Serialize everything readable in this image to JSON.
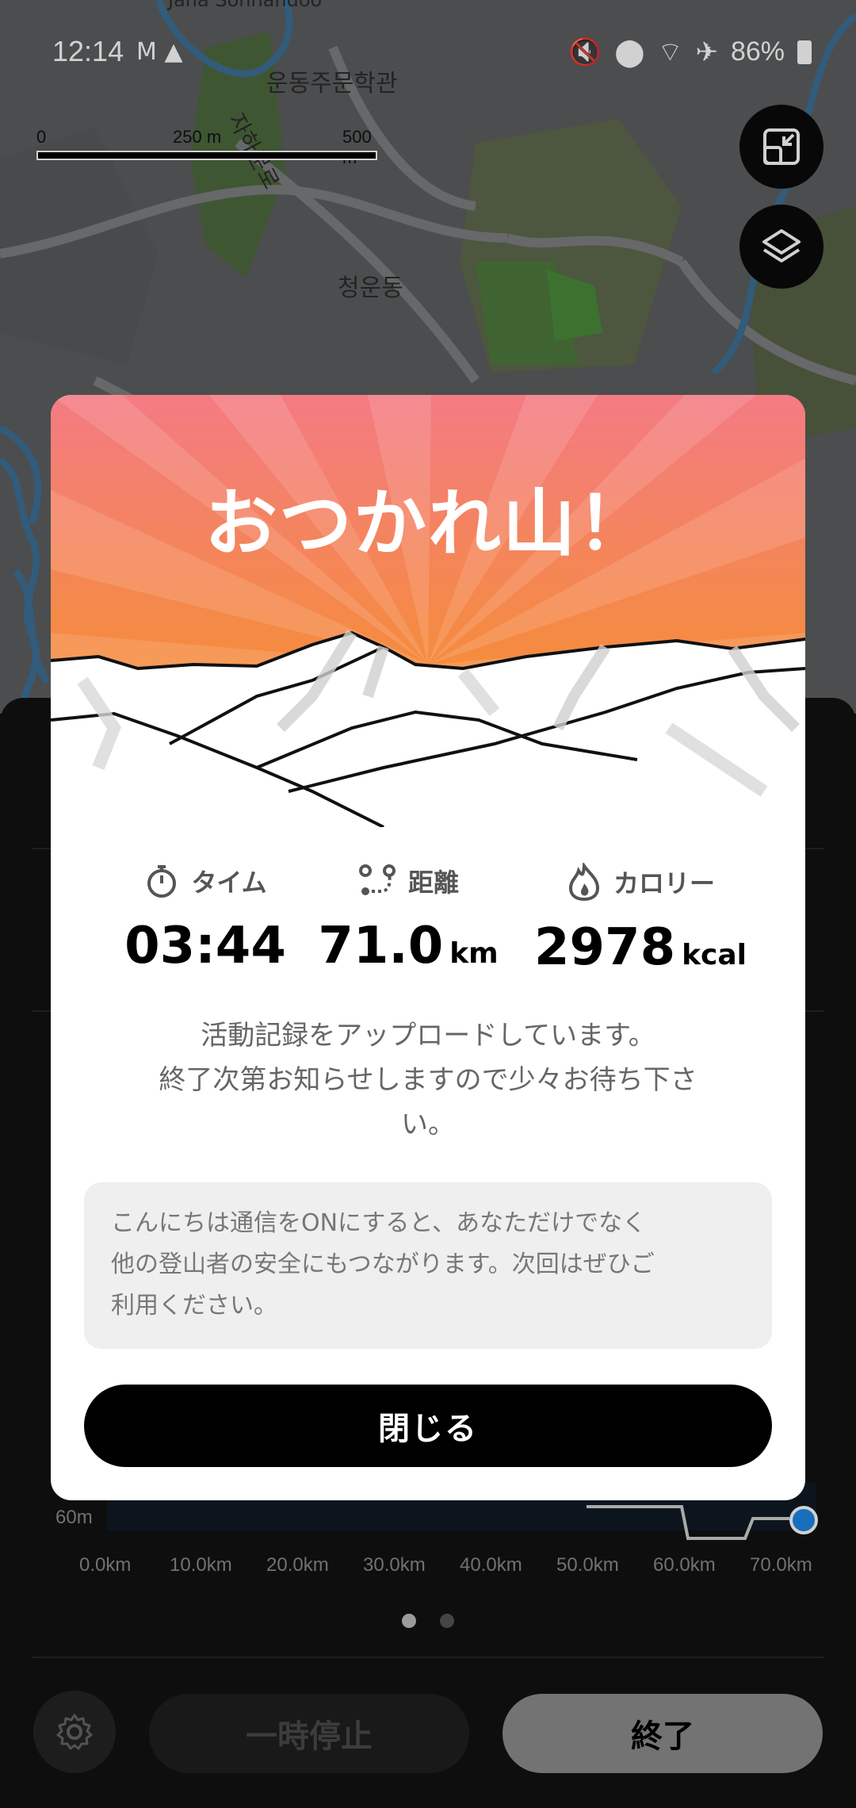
{
  "status_bar": {
    "time": "12:14",
    "battery": "86%",
    "left_icons": [
      "gmail-icon",
      "navigation-icon"
    ],
    "right_icons": [
      "mute-icon",
      "location-icon",
      "wifi-icon",
      "airplane-icon",
      "battery-icon"
    ]
  },
  "map": {
    "labels": {
      "top": "Jana Sohnandoo",
      "school": "운동주문학관",
      "road": "자하문로",
      "district": "청운동"
    },
    "scale": {
      "l0": "0",
      "l1": "250 m",
      "l2": "500 m"
    },
    "buttons": [
      "fullscreen-icon",
      "layers-icon"
    ]
  },
  "modal": {
    "title": "おつかれ山！",
    "stats": [
      {
        "label": "タイム",
        "value": "03:44",
        "unit": "",
        "icon": "stopwatch-icon"
      },
      {
        "label": "距離",
        "value": "71.0",
        "unit": "km",
        "icon": "route-icon"
      },
      {
        "label": "カロリー",
        "value": "2978",
        "unit": "kcal",
        "icon": "flame-icon"
      }
    ],
    "message_lines": [
      "活動記録をアップロードしています。",
      "終了次第お知らせしますので少々お待ち下さ",
      "い。"
    ],
    "notice_lines": [
      "こんにちは通信をONにすると、あなただけでなく",
      "他の登山者の安全にもつながります。次回はぜひご",
      "利用ください。"
    ],
    "close_label": "閉じる"
  },
  "elevation_chart": {
    "y_label": "60m",
    "x_labels": [
      "0.0km",
      "10.0km",
      "20.0km",
      "30.0km",
      "40.0km",
      "50.0km",
      "60.0km",
      "70.0km"
    ]
  },
  "pager": {
    "count": 2,
    "active": 0
  },
  "controls": {
    "pause_label": "一時停止",
    "end_label": "終了"
  },
  "colors": {
    "hero_top": "#f47b84",
    "hero_bottom": "#f6901f",
    "accent": "#1e88e5"
  }
}
